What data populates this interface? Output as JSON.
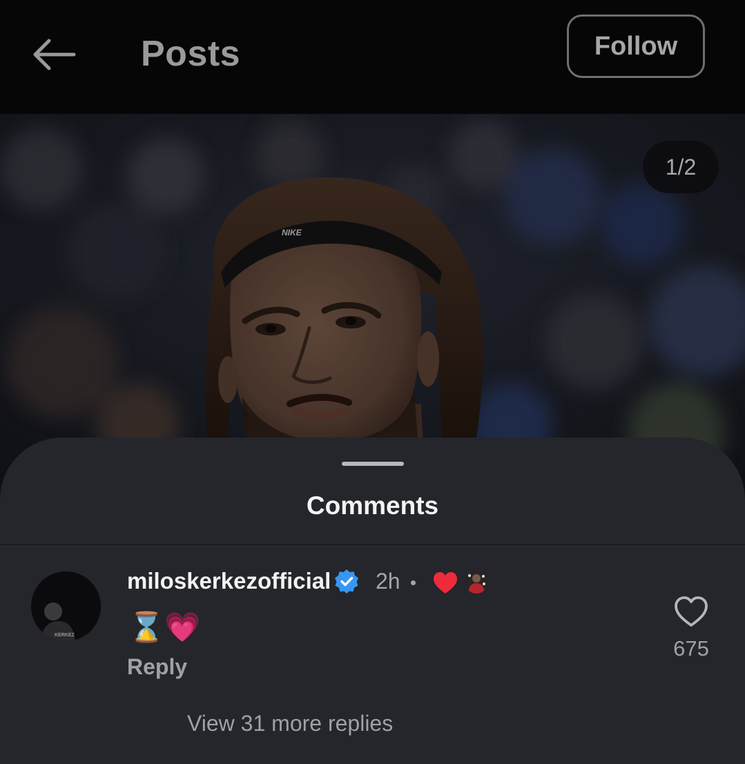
{
  "header": {
    "title": "Posts",
    "follow_label": "Follow",
    "back_icon": "arrow-left-icon"
  },
  "post": {
    "page_indicator": "1/2",
    "headband_text": "NIKE",
    "avatar_jersey_text": "KERKEZ"
  },
  "comments": {
    "title": "Comments",
    "items": [
      {
        "username": "miloskerkezofficial",
        "verified_icon": "verified-badge-icon",
        "time": "2h",
        "author_liked_icon": "red-heart-icon",
        "text": "⌛💗",
        "reply_label": "Reply",
        "like_count": "675",
        "view_replies_label": "View 31 more replies"
      }
    ]
  },
  "colors": {
    "topbar_bg": "#060607",
    "sheet_bg": "#24262b",
    "verified_blue": "#3897f0",
    "heart_red": "#ed2b3b"
  }
}
